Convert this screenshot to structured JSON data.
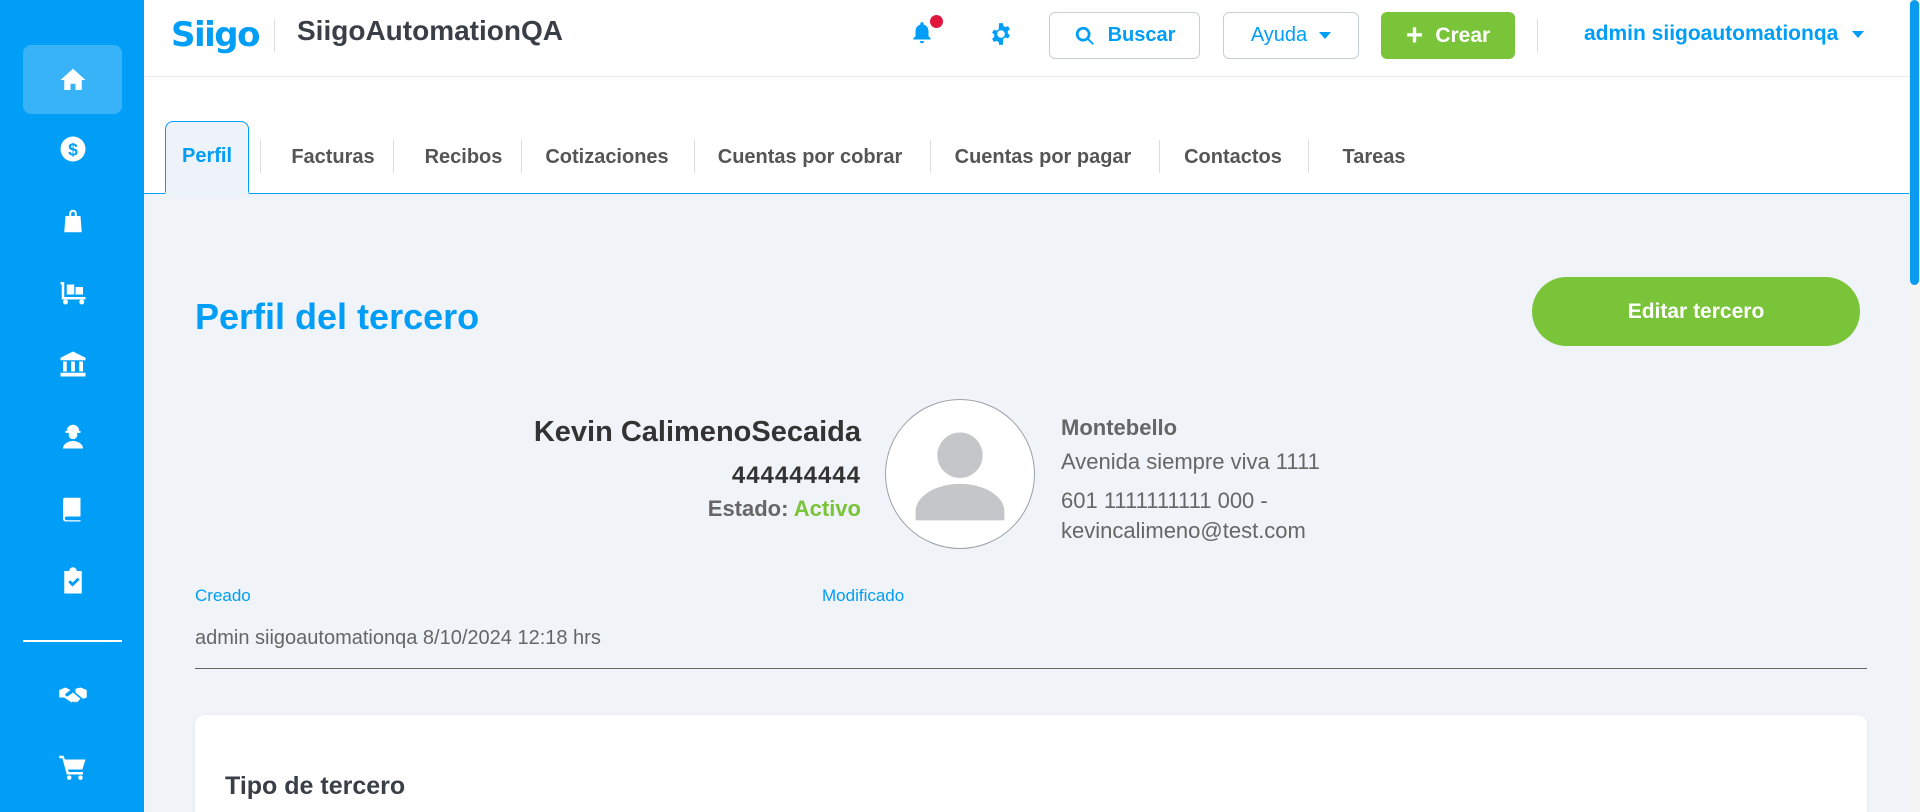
{
  "app": {
    "logo_text": "Siigo",
    "title": "SiigoAutomationQA"
  },
  "header": {
    "search_label": "Buscar",
    "help_label": "Ayuda",
    "create_label": "Crear",
    "user_name": "admin siigoautomationqa",
    "notification_dot_color": "#e0163c"
  },
  "sidebar": {
    "items": [
      {
        "icon": "home-icon",
        "active": true
      },
      {
        "icon": "dollar-icon"
      },
      {
        "icon": "shopping-bag-icon"
      },
      {
        "icon": "cart-dolly-icon"
      },
      {
        "icon": "bank-icon"
      },
      {
        "icon": "worker-icon"
      },
      {
        "icon": "book-icon"
      },
      {
        "icon": "clipboard-check-icon"
      },
      {
        "icon": "handshake-icon"
      },
      {
        "icon": "shopping-cart-icon"
      }
    ]
  },
  "tabs": [
    {
      "label": "Perfil",
      "active": true
    },
    {
      "label": "Facturas"
    },
    {
      "label": "Recibos"
    },
    {
      "label": "Cotizaciones"
    },
    {
      "label": "Cuentas por cobrar"
    },
    {
      "label": "Cuentas por pagar"
    },
    {
      "label": "Contactos"
    },
    {
      "label": "Tareas"
    }
  ],
  "profile": {
    "page_title": "Perfil del tercero",
    "edit_button": "Editar tercero",
    "name": "Kevin CalimenoSecaida",
    "identification": "444444444",
    "status_label": "Estado:",
    "status_value": "Activo",
    "city": "Montebello",
    "address": "Avenida siempre viva 1111",
    "phone": "601 1111111111 000 -",
    "email": "kevincalimeno@test.com",
    "created_label": "Creado",
    "modified_label": "Modificado",
    "created_value": "admin siigoautomationqa 8/10/2024 12:18 hrs"
  },
  "card": {
    "title": "Tipo de tercero"
  },
  "colors": {
    "primary": "#009ef7",
    "success": "#7ac43a",
    "background": "#f0f3f7"
  }
}
